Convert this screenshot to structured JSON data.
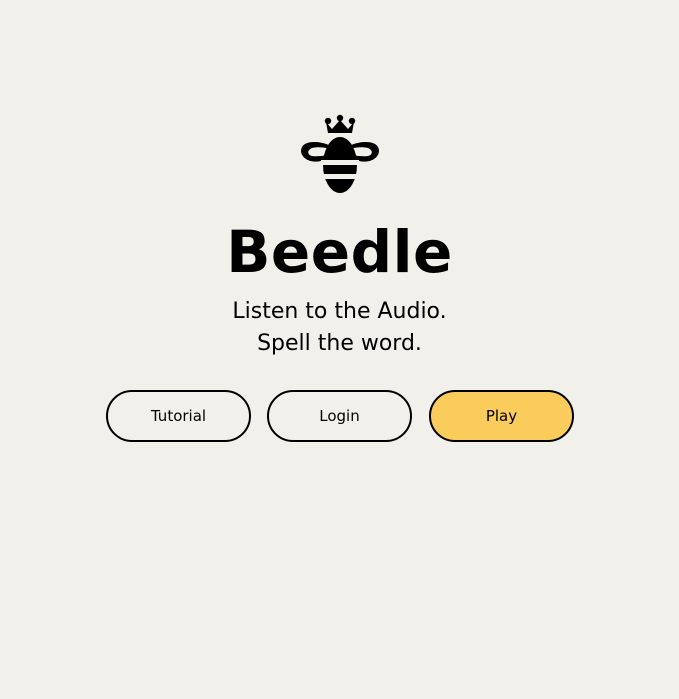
{
  "app": {
    "logo_icon": "crowned-bee-icon",
    "title": "Beedle",
    "tagline_line1": "Listen to the Audio.",
    "tagline_line2": "Spell the word."
  },
  "actions": {
    "tutorial_label": "Tutorial",
    "login_label": "Login",
    "play_label": "Play"
  },
  "colors": {
    "background": "#f1f0eb",
    "accent": "#f9cc5b",
    "ink": "#000000"
  }
}
